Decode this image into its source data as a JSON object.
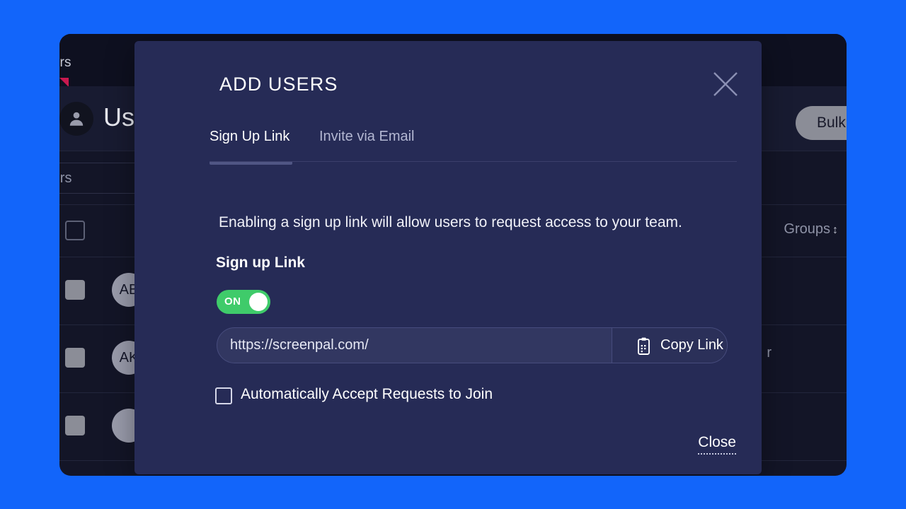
{
  "theme": {
    "page_blue": "#1265fa",
    "app_bg": "#131527",
    "modal_bg": "#262b56",
    "input_bg": "#323761",
    "toggle_on_green": "#3fcb6a",
    "tab_underline": "#505684",
    "tab_marker_pink": "#c9194f",
    "text_primary": "#ffffff",
    "text_muted": "#8e92a6"
  },
  "background_app": {
    "tab_label": "sers",
    "tab_marker_icon": "triangle-marker-icon",
    "header_icon": "person-avatar-icon",
    "header_title": "Us",
    "bulk_button_label": "Bulk Use",
    "filters_label": "Filters",
    "column_headers": {
      "select_all": "",
      "groups": "Groups",
      "sort_glyph": "↕"
    },
    "rows": [
      {
        "avatar_initials": "AB",
        "tail_text": ""
      },
      {
        "avatar_initials": "AK",
        "tail_text": "r"
      },
      {
        "avatar_initials": "",
        "tail_text": ""
      }
    ]
  },
  "modal": {
    "title": "ADD USERS",
    "close_icon": "close-x-icon",
    "tabs": [
      {
        "label": "Sign Up Link",
        "active": true
      },
      {
        "label": "Invite via Email",
        "active": false
      }
    ],
    "description": "Enabling a sign up link will allow users to request access to your team.",
    "signup_link_section": {
      "label": "Sign up Link",
      "toggle": {
        "state_label": "ON",
        "enabled": true
      },
      "link_value": "https://screenpal.com/",
      "link_placeholder": "https://screenpal.com/",
      "copy_button": {
        "label": "Copy Link",
        "icon": "clipboard-copy-icon"
      }
    },
    "auto_accept": {
      "label": "Automatically Accept Requests to Join",
      "checked": false,
      "icon": "checkbox-unchecked-icon"
    },
    "footer": {
      "close_label": "Close"
    }
  }
}
